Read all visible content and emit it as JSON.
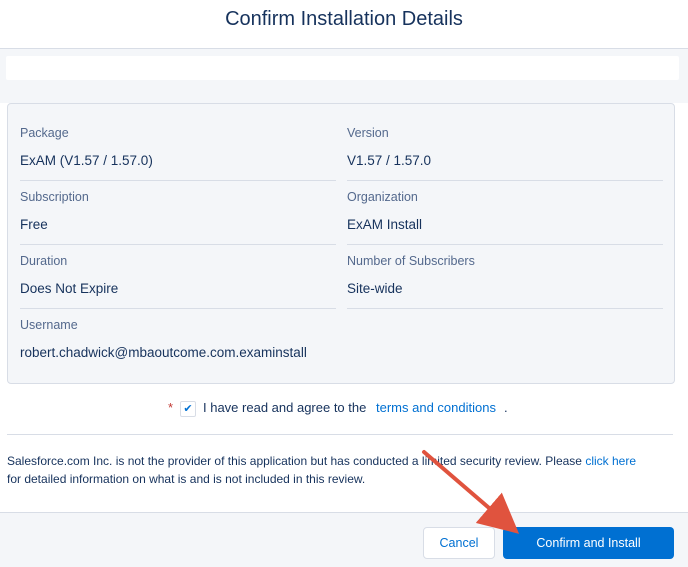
{
  "header": {
    "title": "Confirm Installation Details"
  },
  "details": {
    "package": {
      "label": "Package",
      "value": "ExAM (V1.57 / 1.57.0)"
    },
    "version": {
      "label": "Version",
      "value": "V1.57 / 1.57.0"
    },
    "subscription": {
      "label": "Subscription",
      "value": "Free"
    },
    "organization": {
      "label": "Organization",
      "value": "ExAM Install"
    },
    "duration": {
      "label": "Duration",
      "value": "Does Not Expire"
    },
    "subscribers": {
      "label": "Number of Subscribers",
      "value": "Site-wide"
    },
    "username": {
      "label": "Username",
      "value": "robert.chadwick@mbaoutcome.com.examinstall"
    }
  },
  "agreement": {
    "required_mark": "*",
    "checked": true,
    "text": "I have read and agree to the",
    "link": "terms and conditions",
    "end": "."
  },
  "notice": {
    "text_before": "Salesforce.com Inc. is not the provider of this application but has conducted a limited security review. Please",
    "link": "click here",
    "text_after": "for detailed information on what is and is not included in this review."
  },
  "footer": {
    "cancel_label": "Cancel",
    "confirm_label": "Confirm and Install"
  },
  "colors": {
    "accent": "#0070d2",
    "arrow": "#e0533e",
    "text": "#16325c"
  }
}
